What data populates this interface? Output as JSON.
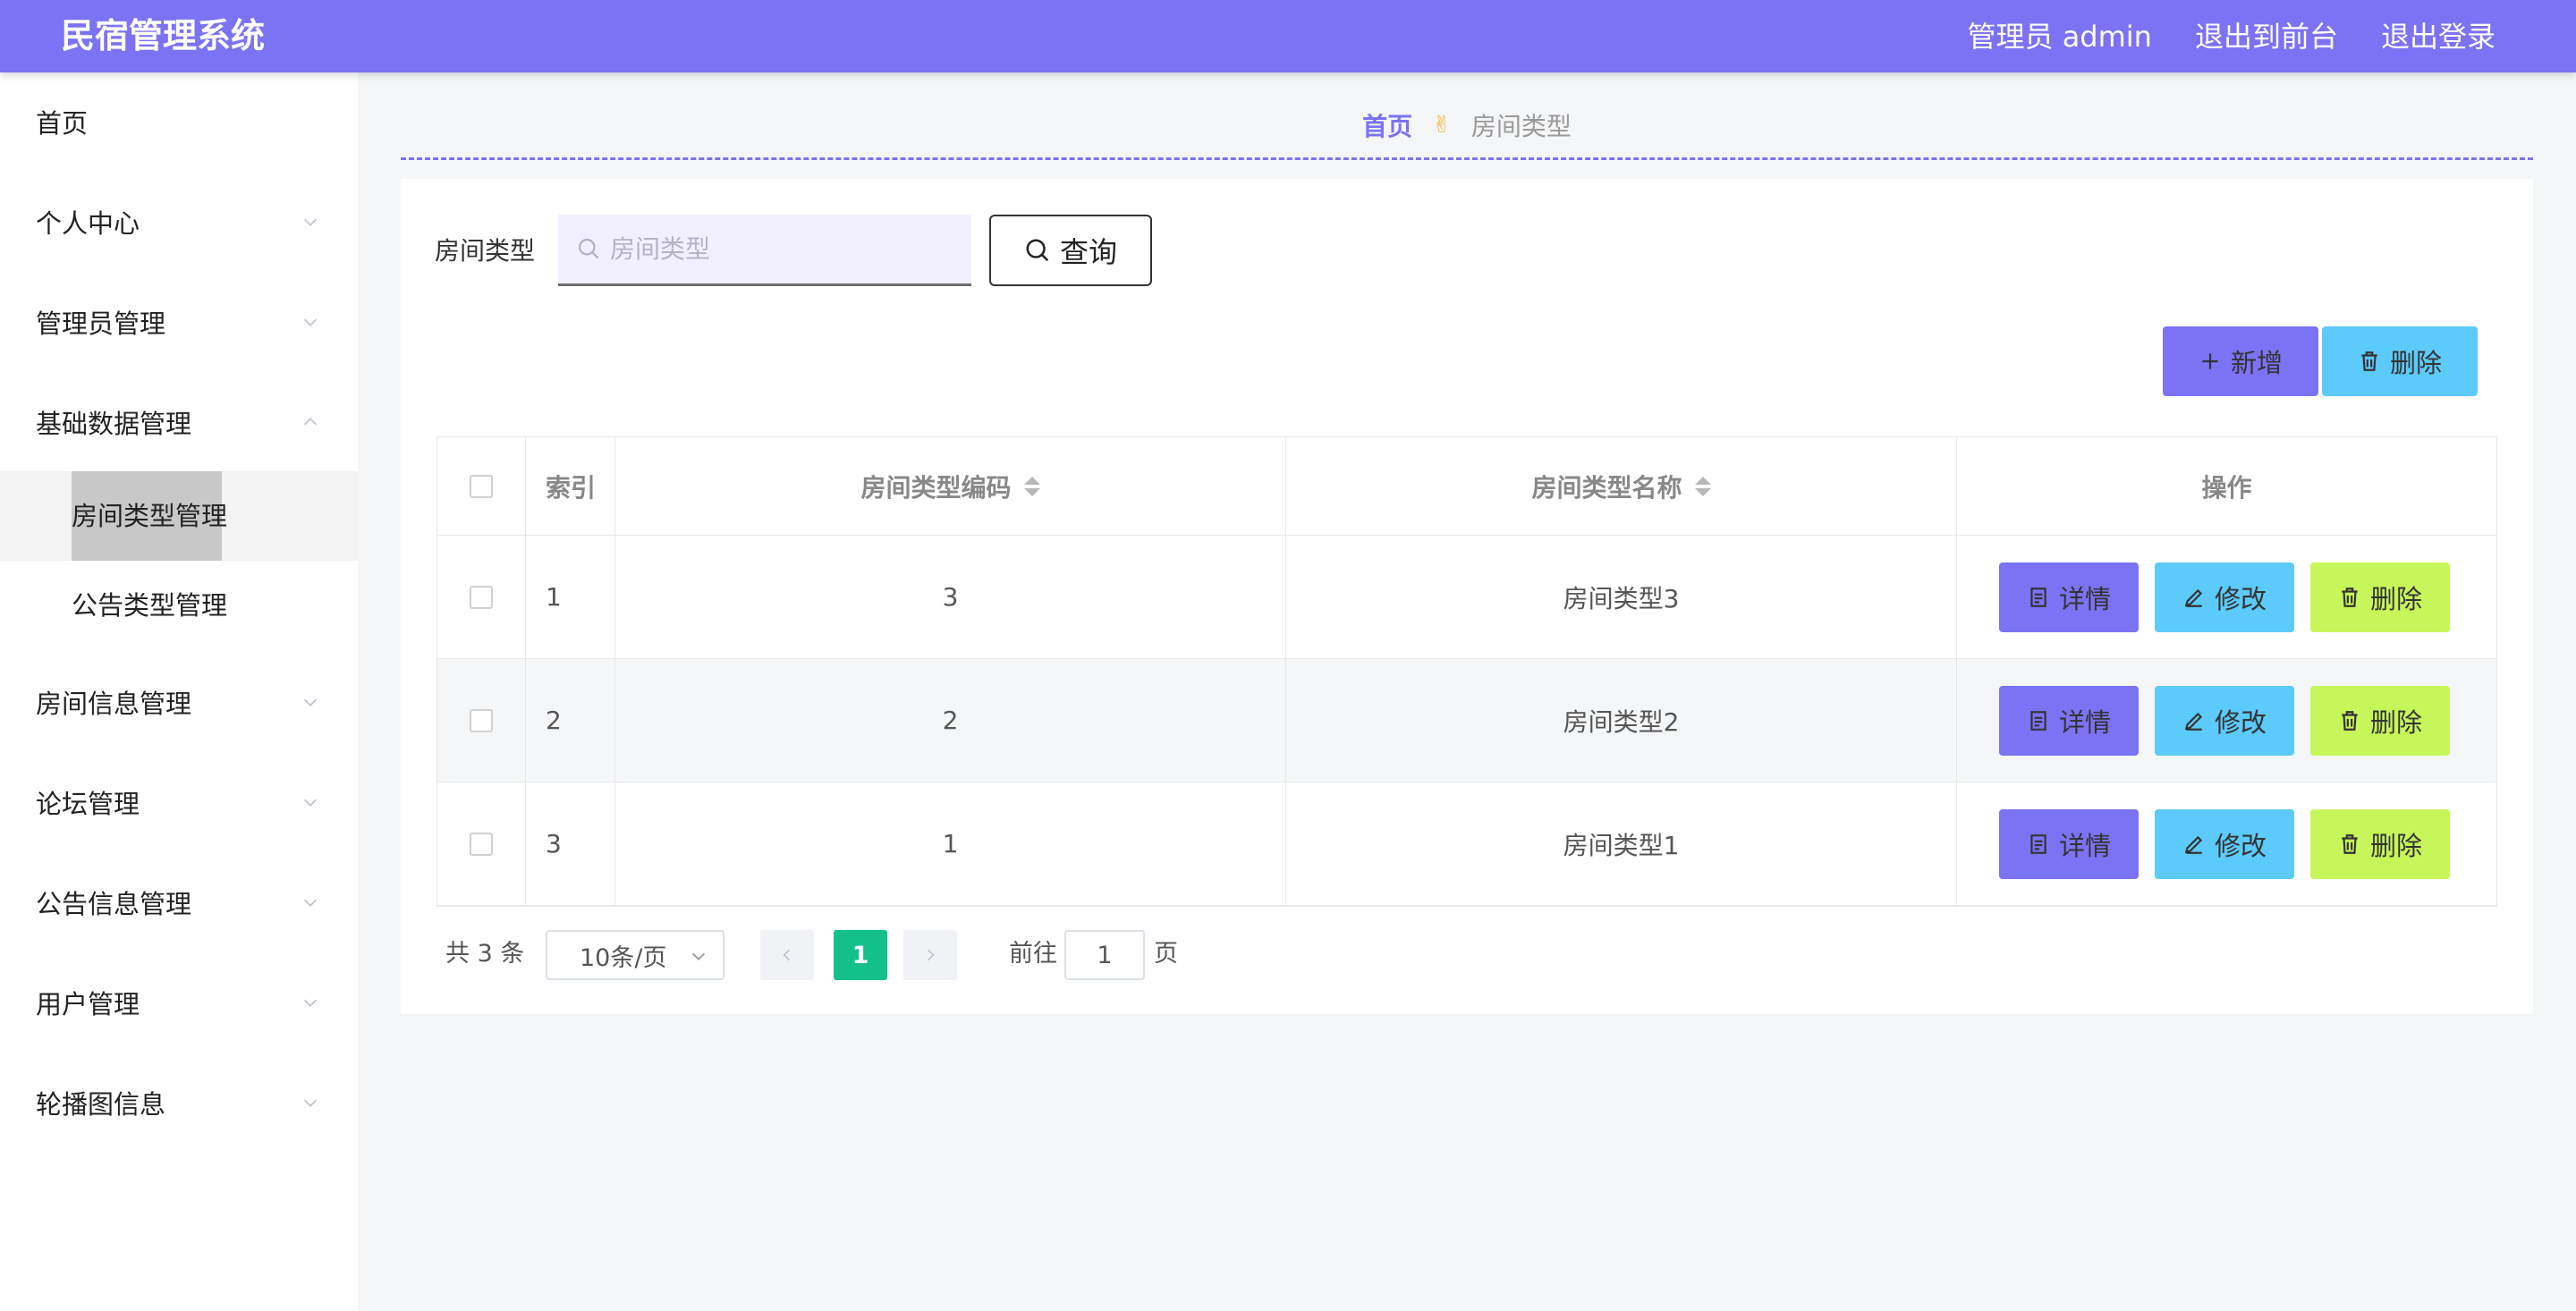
{
  "header": {
    "app_title": "民宿管理系统",
    "admin_label": "管理员 admin",
    "to_frontend": "退出到前台",
    "logout": "退出登录"
  },
  "sidebar": {
    "items": [
      {
        "label": "首页"
      },
      {
        "label": "个人中心"
      },
      {
        "label": "管理员管理"
      },
      {
        "label": "基础数据管理"
      },
      {
        "label": "房间信息管理"
      },
      {
        "label": "论坛管理"
      },
      {
        "label": "公告信息管理"
      },
      {
        "label": "用户管理"
      },
      {
        "label": "轮播图信息"
      }
    ],
    "sub_items": [
      {
        "label": "房间类型管理",
        "active": true
      },
      {
        "label": "公告类型管理",
        "active": false
      }
    ]
  },
  "breadcrumb": {
    "home": "首页",
    "separator_icon": "✌",
    "current": "房间类型"
  },
  "search": {
    "label": "房间类型",
    "placeholder": "房间类型",
    "value": "",
    "query_button": "查询"
  },
  "toolbar": {
    "add_label": "新增",
    "delete_label": "删除"
  },
  "table": {
    "columns": [
      "索引",
      "房间类型编码",
      "房间类型名称",
      "操作"
    ],
    "rows": [
      {
        "index": "1",
        "code": "3",
        "name": "房间类型3"
      },
      {
        "index": "2",
        "code": "2",
        "name": "房间类型2"
      },
      {
        "index": "3",
        "code": "1",
        "name": "房间类型1"
      }
    ],
    "actions": {
      "detail": "详情",
      "edit": "修改",
      "delete": "删除"
    }
  },
  "pagination": {
    "total_text": "共 3 条",
    "page_size": "10条/页",
    "current_page": "1",
    "goto_label": "前往",
    "goto_value": "1",
    "page_unit": "页"
  },
  "colors": {
    "primary": "#7b73f4",
    "info": "#5ccafa",
    "success": "#13c08a",
    "lime": "#c7f65a"
  }
}
